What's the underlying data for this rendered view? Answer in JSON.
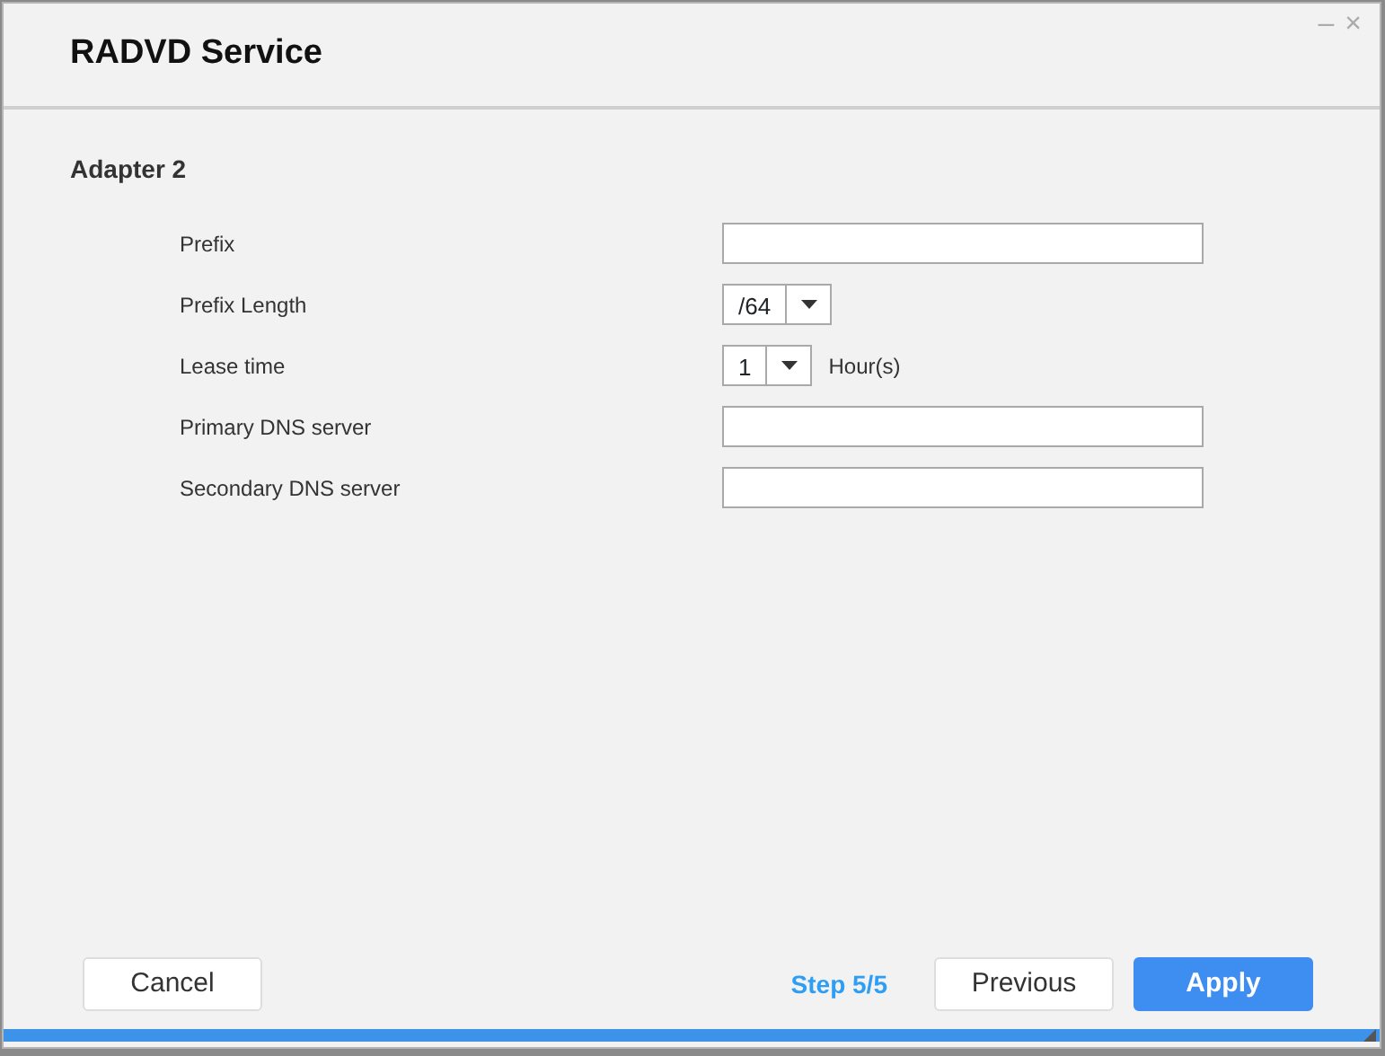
{
  "window": {
    "title": "RADVD Service",
    "controls": [
      "–",
      "×"
    ]
  },
  "section": {
    "title": "Adapter 2"
  },
  "fields": [
    {
      "label": "Prefix",
      "kind": "text"
    },
    {
      "label": "Prefix Length",
      "kind": "select",
      "value": "/64"
    },
    {
      "label": "Lease time",
      "kind": "select",
      "value": "1",
      "unit": "Hour(s)"
    },
    {
      "label": "Primary DNS server",
      "kind": "text"
    },
    {
      "label": "Secondary DNS server",
      "kind": "text"
    }
  ],
  "footer": {
    "cancel": "Cancel",
    "step": "Step 5/5",
    "previous": "Previous",
    "apply": "Apply"
  }
}
